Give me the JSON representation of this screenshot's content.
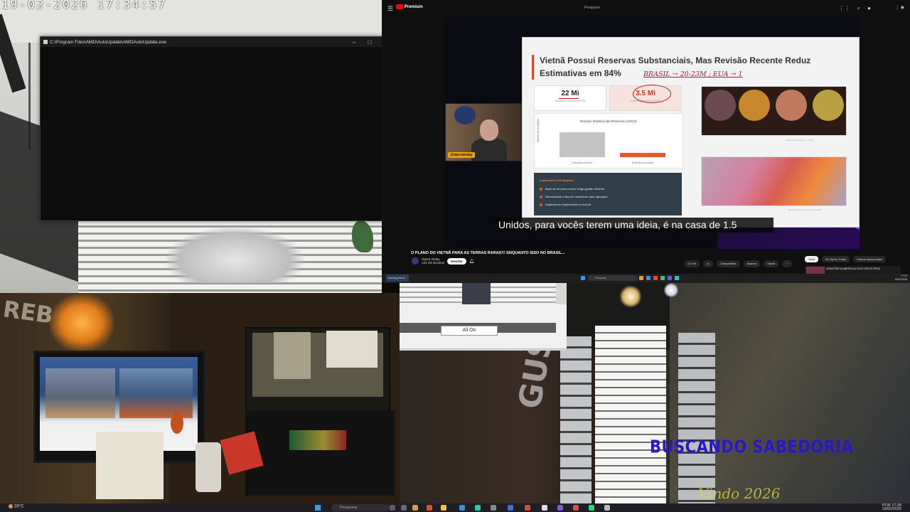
{
  "camera_top_left": {
    "timestamp": "19-02-2026 17:34:57"
  },
  "console_window": {
    "title": "C:\\Program Files\\AMD\\AutoUpdate\\AMDAutoUpdate.exe",
    "minimize": "–",
    "maximize": "□",
    "close": "✕"
  },
  "youtube": {
    "logo_text": "Premium",
    "header_center": "Pesquisar",
    "video_title": "O PLANO DO VIETNÃ PARA AS TERRAS RARAS!!! ENQUANTO ISSO NO BRASIL...",
    "channel_name": "Opera Today",
    "channel_subs": "123 mil inscritos",
    "subscribe_label": "Inscrito",
    "actions": [
      "1,1 mil",
      "Compartilhar",
      "Assinar",
      "Salvar"
    ],
    "chips": [
      "Tudo",
      "De Opera Today",
      "Vídeos relacionados"
    ],
    "side_video_title": "ASSISTÊNCIA ABERTA AO VIVO SEXTA-FEIRA",
    "taskbar_search": "Pesquisar",
    "taskbar_time": "17:34",
    "taskbar_date": "19/02/2026",
    "subtitle": "Unidos, para vocês terem uma ideia, é na casa de 1.5",
    "webcam_tag": "@operatoday",
    "notification": "Trending videos"
  },
  "slide": {
    "title": "Vietnã Possui Reservas Substanciais, Mas Revisão Recente Reduz Estimativas em 84%",
    "handwriting": "BRASIL → 20-23M ; EUA → 1",
    "stat1_value": "22 Mi",
    "stat1_label": "Estimativa anterior (USGS)",
    "stat2_value": "3.5 Mi",
    "stat2_label": "Estimativa revisada (2024)",
    "chart_title": "Revisão Drástica das Reservas (USGS)",
    "chart_ylabel": "Milhões de toneladas",
    "panel_heading": "Implicações Estratégicas",
    "panel_items": [
      "Base de recursos menor exige gestão eficiente",
      "Necessidade crítica de maximizar valor agregado",
      "Urgência em implementar a nova lei"
    ],
    "caption1": "Exploração mineral no Vietnã",
    "caption2": "Minério de terras raras processado"
  },
  "chart_data": {
    "type": "bar",
    "title": "Revisão Drástica das Reservas (USGS)",
    "ylabel": "Milhões de toneladas",
    "categories": [
      "Estimativa anterior",
      "Estimativa revisada"
    ],
    "values": [
      22,
      3.5
    ],
    "colors": [
      "#c4c4c4",
      "#e55a2c"
    ],
    "ylim": [
      0,
      25
    ]
  },
  "camera_bottom_left": {
    "graffiti": "REB"
  },
  "camera_bottom_right": {
    "button_label": "All On",
    "graffiti": "GUS",
    "watermark_main": "BUSCANDO SABEDORIA",
    "watermark_sub": "Vindo 2026"
  },
  "taskbar": {
    "weather": "28°C",
    "search_placeholder": "Pesquisar",
    "language": "POR",
    "time": "17:35",
    "date": "19/02/2026"
  }
}
